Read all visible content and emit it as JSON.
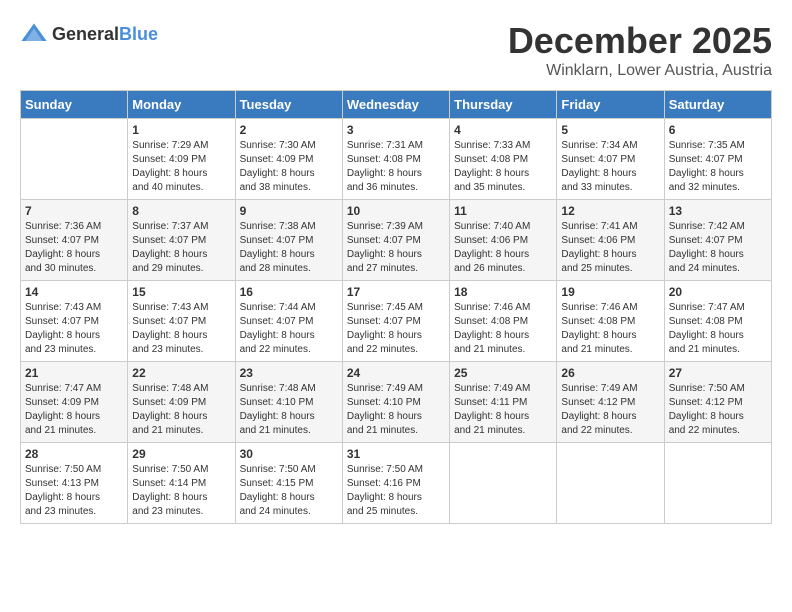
{
  "header": {
    "logo_general": "General",
    "logo_blue": "Blue",
    "month": "December 2025",
    "location": "Winklarn, Lower Austria, Austria"
  },
  "days_of_week": [
    "Sunday",
    "Monday",
    "Tuesday",
    "Wednesday",
    "Thursday",
    "Friday",
    "Saturday"
  ],
  "weeks": [
    [
      {
        "num": "",
        "info": ""
      },
      {
        "num": "1",
        "info": "Sunrise: 7:29 AM\nSunset: 4:09 PM\nDaylight: 8 hours\nand 40 minutes."
      },
      {
        "num": "2",
        "info": "Sunrise: 7:30 AM\nSunset: 4:09 PM\nDaylight: 8 hours\nand 38 minutes."
      },
      {
        "num": "3",
        "info": "Sunrise: 7:31 AM\nSunset: 4:08 PM\nDaylight: 8 hours\nand 36 minutes."
      },
      {
        "num": "4",
        "info": "Sunrise: 7:33 AM\nSunset: 4:08 PM\nDaylight: 8 hours\nand 35 minutes."
      },
      {
        "num": "5",
        "info": "Sunrise: 7:34 AM\nSunset: 4:07 PM\nDaylight: 8 hours\nand 33 minutes."
      },
      {
        "num": "6",
        "info": "Sunrise: 7:35 AM\nSunset: 4:07 PM\nDaylight: 8 hours\nand 32 minutes."
      }
    ],
    [
      {
        "num": "7",
        "info": "Sunrise: 7:36 AM\nSunset: 4:07 PM\nDaylight: 8 hours\nand 30 minutes."
      },
      {
        "num": "8",
        "info": "Sunrise: 7:37 AM\nSunset: 4:07 PM\nDaylight: 8 hours\nand 29 minutes."
      },
      {
        "num": "9",
        "info": "Sunrise: 7:38 AM\nSunset: 4:07 PM\nDaylight: 8 hours\nand 28 minutes."
      },
      {
        "num": "10",
        "info": "Sunrise: 7:39 AM\nSunset: 4:07 PM\nDaylight: 8 hours\nand 27 minutes."
      },
      {
        "num": "11",
        "info": "Sunrise: 7:40 AM\nSunset: 4:06 PM\nDaylight: 8 hours\nand 26 minutes."
      },
      {
        "num": "12",
        "info": "Sunrise: 7:41 AM\nSunset: 4:06 PM\nDaylight: 8 hours\nand 25 minutes."
      },
      {
        "num": "13",
        "info": "Sunrise: 7:42 AM\nSunset: 4:07 PM\nDaylight: 8 hours\nand 24 minutes."
      }
    ],
    [
      {
        "num": "14",
        "info": "Sunrise: 7:43 AM\nSunset: 4:07 PM\nDaylight: 8 hours\nand 23 minutes."
      },
      {
        "num": "15",
        "info": "Sunrise: 7:43 AM\nSunset: 4:07 PM\nDaylight: 8 hours\nand 23 minutes."
      },
      {
        "num": "16",
        "info": "Sunrise: 7:44 AM\nSunset: 4:07 PM\nDaylight: 8 hours\nand 22 minutes."
      },
      {
        "num": "17",
        "info": "Sunrise: 7:45 AM\nSunset: 4:07 PM\nDaylight: 8 hours\nand 22 minutes."
      },
      {
        "num": "18",
        "info": "Sunrise: 7:46 AM\nSunset: 4:08 PM\nDaylight: 8 hours\nand 21 minutes."
      },
      {
        "num": "19",
        "info": "Sunrise: 7:46 AM\nSunset: 4:08 PM\nDaylight: 8 hours\nand 21 minutes."
      },
      {
        "num": "20",
        "info": "Sunrise: 7:47 AM\nSunset: 4:08 PM\nDaylight: 8 hours\nand 21 minutes."
      }
    ],
    [
      {
        "num": "21",
        "info": "Sunrise: 7:47 AM\nSunset: 4:09 PM\nDaylight: 8 hours\nand 21 minutes."
      },
      {
        "num": "22",
        "info": "Sunrise: 7:48 AM\nSunset: 4:09 PM\nDaylight: 8 hours\nand 21 minutes."
      },
      {
        "num": "23",
        "info": "Sunrise: 7:48 AM\nSunset: 4:10 PM\nDaylight: 8 hours\nand 21 minutes."
      },
      {
        "num": "24",
        "info": "Sunrise: 7:49 AM\nSunset: 4:10 PM\nDaylight: 8 hours\nand 21 minutes."
      },
      {
        "num": "25",
        "info": "Sunrise: 7:49 AM\nSunset: 4:11 PM\nDaylight: 8 hours\nand 21 minutes."
      },
      {
        "num": "26",
        "info": "Sunrise: 7:49 AM\nSunset: 4:12 PM\nDaylight: 8 hours\nand 22 minutes."
      },
      {
        "num": "27",
        "info": "Sunrise: 7:50 AM\nSunset: 4:12 PM\nDaylight: 8 hours\nand 22 minutes."
      }
    ],
    [
      {
        "num": "28",
        "info": "Sunrise: 7:50 AM\nSunset: 4:13 PM\nDaylight: 8 hours\nand 23 minutes."
      },
      {
        "num": "29",
        "info": "Sunrise: 7:50 AM\nSunset: 4:14 PM\nDaylight: 8 hours\nand 23 minutes."
      },
      {
        "num": "30",
        "info": "Sunrise: 7:50 AM\nSunset: 4:15 PM\nDaylight: 8 hours\nand 24 minutes."
      },
      {
        "num": "31",
        "info": "Sunrise: 7:50 AM\nSunset: 4:16 PM\nDaylight: 8 hours\nand 25 minutes."
      },
      {
        "num": "",
        "info": ""
      },
      {
        "num": "",
        "info": ""
      },
      {
        "num": "",
        "info": ""
      }
    ]
  ]
}
